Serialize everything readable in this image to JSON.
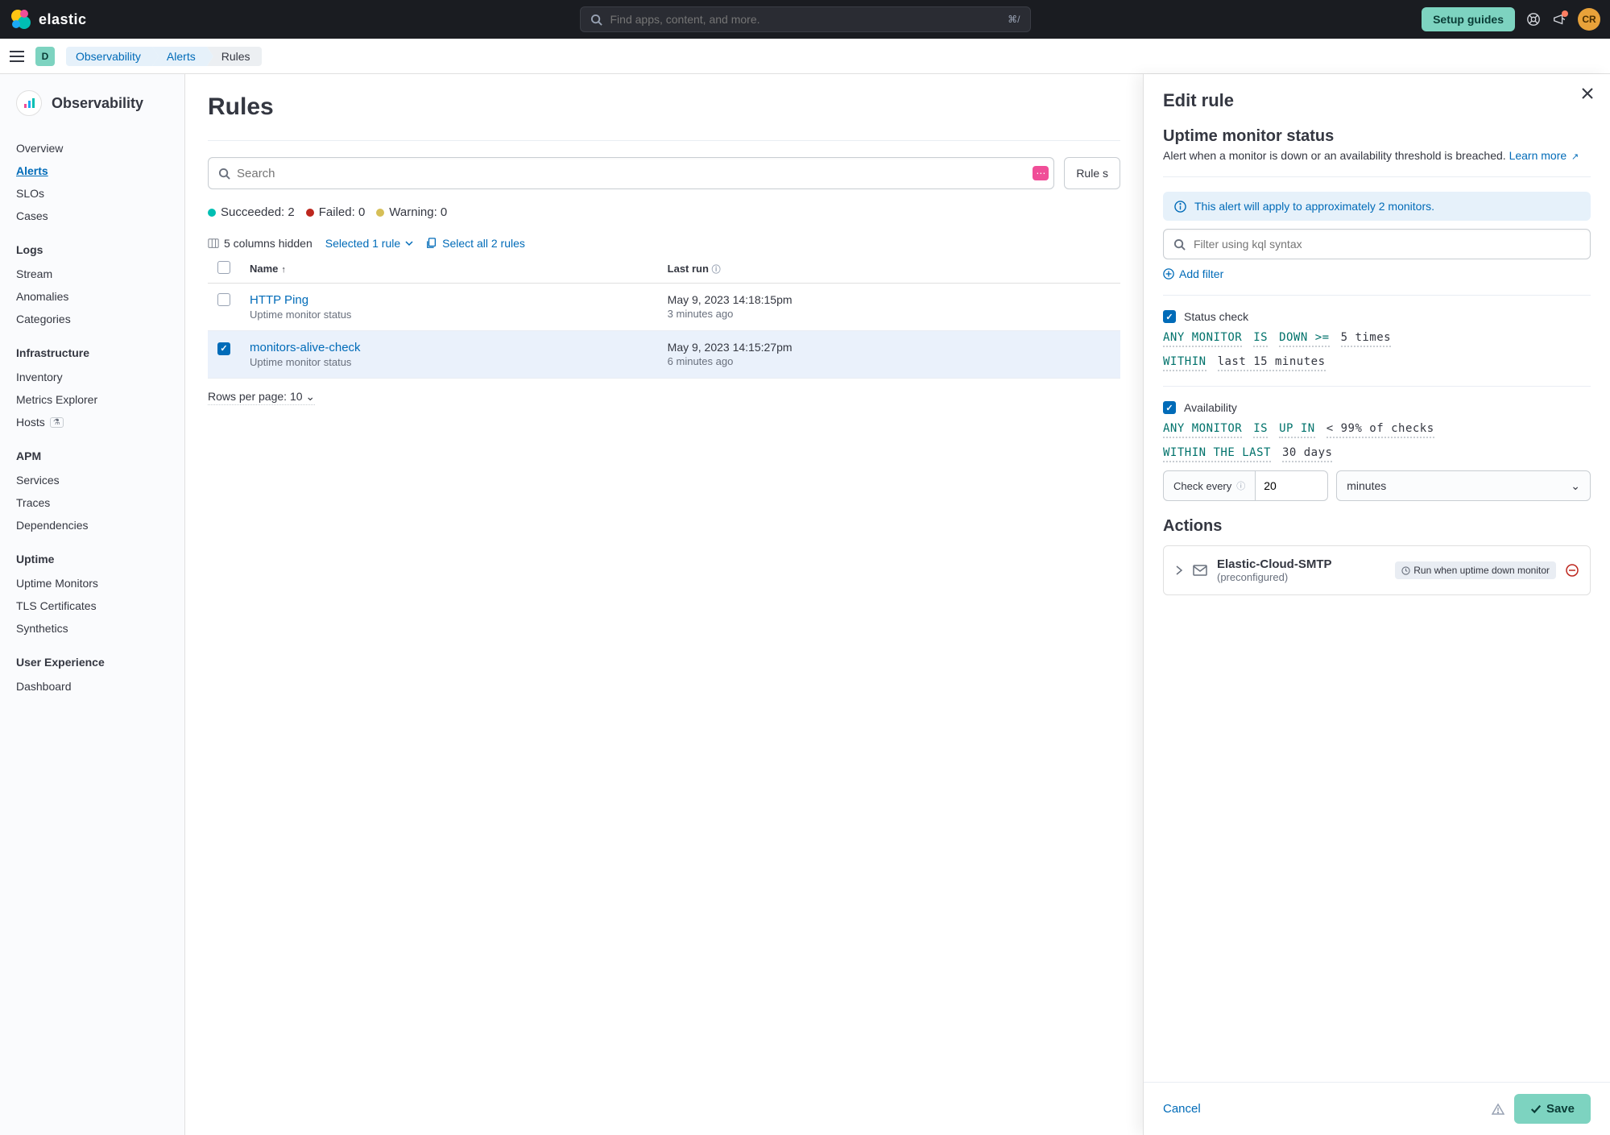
{
  "header": {
    "search_placeholder": "Find apps, content, and more.",
    "search_shortcut": "⌘/",
    "setup_guides": "Setup guides",
    "avatar_initials": "CR"
  },
  "secondary_nav": {
    "avatar_letter": "D",
    "breadcrumb": [
      "Observability",
      "Alerts",
      "Rules"
    ]
  },
  "sidebar": {
    "title": "Observability",
    "items_top": [
      {
        "label": "Overview"
      },
      {
        "label": "Alerts",
        "active": true
      },
      {
        "label": "SLOs"
      },
      {
        "label": "Cases"
      }
    ],
    "sections": [
      {
        "heading": "Logs",
        "items": [
          "Stream",
          "Anomalies",
          "Categories"
        ]
      },
      {
        "heading": "Infrastructure",
        "items": [
          "Inventory",
          "Metrics Explorer",
          "Hosts"
        ],
        "beta_on": "Hosts"
      },
      {
        "heading": "APM",
        "items": [
          "Services",
          "Traces",
          "Dependencies"
        ]
      },
      {
        "heading": "Uptime",
        "items": [
          "Uptime Monitors",
          "TLS Certificates",
          "Synthetics"
        ]
      },
      {
        "heading": "User Experience",
        "items": [
          "Dashboard"
        ]
      }
    ]
  },
  "content": {
    "page_title": "Rules",
    "search_placeholder": "Search",
    "rule_status_btn": "Rule s",
    "status_succeeded": "Succeeded: 2",
    "status_failed": "Failed: 0",
    "status_warning": "Warning: 0",
    "columns_hidden": "5 columns hidden",
    "selected_rule": "Selected 1 rule",
    "select_all": "Select all 2 rules",
    "col_name": "Name",
    "col_last_run": "Last run",
    "rules": [
      {
        "name": "HTTP Ping",
        "subtitle": "Uptime monitor status",
        "last_run": "May 9, 2023 14:18:15pm",
        "last_run_rel": "3 minutes ago",
        "selected": false
      },
      {
        "name": "monitors-alive-check",
        "subtitle": "Uptime monitor status",
        "last_run": "May 9, 2023 14:15:27pm",
        "last_run_rel": "6 minutes ago",
        "selected": true
      }
    ],
    "rows_per_page": "Rows per page: 10"
  },
  "flyout": {
    "title": "Edit rule",
    "rule_type_title": "Uptime monitor status",
    "rule_type_desc": "Alert when a monitor is down or an availability threshold is breached. ",
    "learn_more": "Learn more",
    "info_callout": "This alert will apply to approximately 2 monitors.",
    "kql_placeholder": "Filter using kql syntax",
    "add_filter": "Add filter",
    "status_check_label": "Status check",
    "avail_label": "Availability",
    "status_expr_tokens": [
      {
        "t": "ANY MONITOR",
        "kw": true
      },
      {
        "t": "IS",
        "kw": true
      },
      {
        "t": "DOWN >=",
        "kw": true
      },
      {
        "t": "5 times",
        "kw": false
      }
    ],
    "status_within_tokens": [
      {
        "t": "WITHIN",
        "kw": true
      },
      {
        "t": "last 15 minutes",
        "kw": false
      }
    ],
    "avail_expr_tokens": [
      {
        "t": "ANY MONITOR",
        "kw": true
      },
      {
        "t": "IS",
        "kw": true
      },
      {
        "t": "UP IN",
        "kw": true
      },
      {
        "t": "< 99% of checks",
        "kw": false
      }
    ],
    "avail_within_tokens": [
      {
        "t": "WITHIN THE LAST",
        "kw": true
      },
      {
        "t": "30 days",
        "kw": false
      }
    ],
    "check_every_label": "Check every",
    "check_every_value": "20",
    "check_every_unit": "minutes",
    "actions_heading": "Actions",
    "action": {
      "name": "Elastic-Cloud-SMTP",
      "sub": "(preconfigured)",
      "run_label": "Run when uptime down monitor"
    },
    "cancel": "Cancel",
    "save": "Save"
  }
}
